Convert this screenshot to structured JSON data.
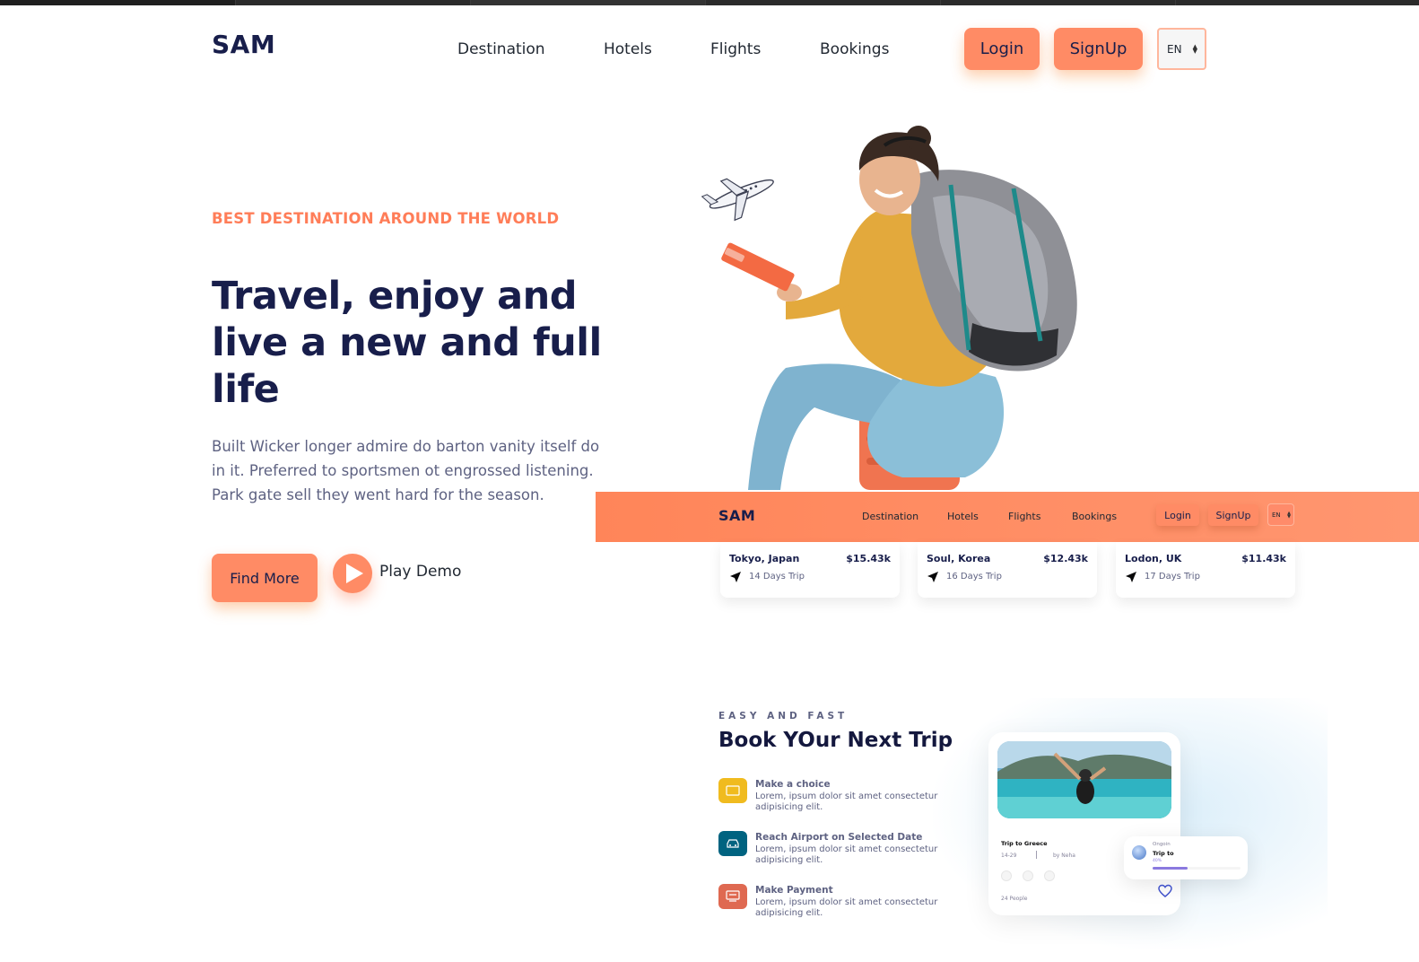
{
  "brand": {
    "logo": "SAM"
  },
  "nav": {
    "links": [
      "Destination",
      "Hotels",
      "Flights",
      "Bookings"
    ],
    "login": "Login",
    "signup": "SignUp",
    "language": "EN"
  },
  "hero": {
    "eyebrow": "BEST DESTINATION AROUND THE WORLD",
    "headline": "Travel, enjoy and live a new and full life",
    "description": "Built Wicker longer admire do barton vanity itself do in it. Preferred to sportsmen ot engrossed listening. Park gate sell they went hard for the season.",
    "find_more": "Find More",
    "play_demo": "Play Demo"
  },
  "banner": {
    "logo": "SAM",
    "links": [
      "Destination",
      "Hotels",
      "Flights",
      "Bookings"
    ],
    "login": "Login",
    "signup": "SignUp",
    "language": "EN"
  },
  "destinations": [
    {
      "city": "Tokyo, Japan",
      "price": "$15.43k",
      "trip": "14 Days Trip"
    },
    {
      "city": "Soul, Korea",
      "price": "$12.43k",
      "trip": "16 Days Trip"
    },
    {
      "city": "Lodon, UK",
      "price": "$11.43k",
      "trip": "17 Days Trip"
    }
  ],
  "booking": {
    "eyebrow": "EASY AND FAST",
    "title": "Book YOur Next Trip",
    "steps": [
      {
        "title": "Make a choice",
        "desc": "Lorem, ipsum dolor sit amet consectetur adipisicing elit.",
        "icon": "selection-icon",
        "color": "#f0bb1f"
      },
      {
        "title": "Reach Airport on Selected Date",
        "desc": "Lorem, ipsum dolor sit amet consectetur adipisicing elit.",
        "icon": "car-icon",
        "color": "#006380"
      },
      {
        "title": "Make Payment",
        "desc": "Lorem, ipsum dolor sit amet consectetur adipisicing elit.",
        "icon": "payment-icon",
        "color": "#df6951"
      }
    ],
    "trip_card": {
      "name": "Trip to Greece",
      "dates": "14-29",
      "separator": "|",
      "by": "by Neha",
      "people": "24 People"
    },
    "ongoing": {
      "label": "Ongoin",
      "title": "Trip to",
      "progress_label": "40%",
      "progress": 0.4
    }
  },
  "colors": {
    "accent": "#ff8b65",
    "navy": "#181e4b",
    "eyebrow": "#ff7d58",
    "text_muted": "#5e6282"
  }
}
